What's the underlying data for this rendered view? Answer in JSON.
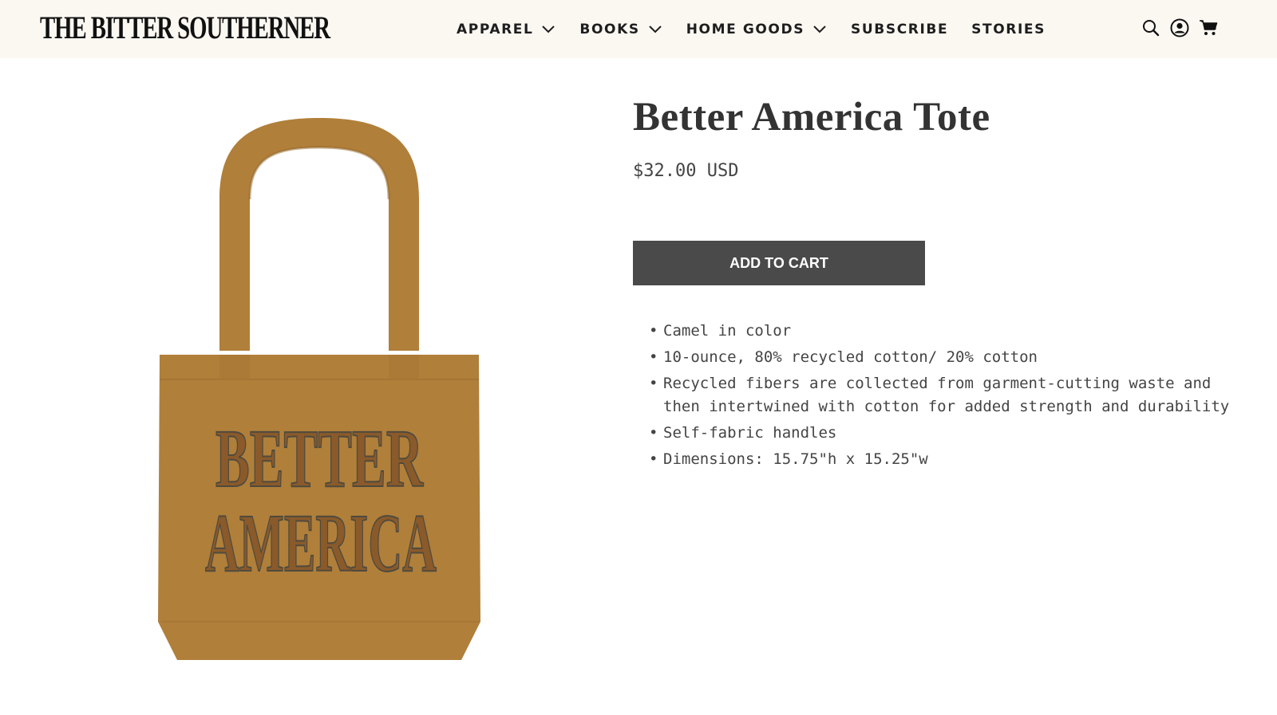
{
  "header": {
    "logo_text": "THE BITTER SOUTHERNER",
    "nav": [
      {
        "label": "APPAREL",
        "has_dropdown": true
      },
      {
        "label": "BOOKS",
        "has_dropdown": true
      },
      {
        "label": "HOME GOODS",
        "has_dropdown": true
      },
      {
        "label": "SUBSCRIBE",
        "has_dropdown": false
      },
      {
        "label": "STORIES",
        "has_dropdown": false
      }
    ],
    "icons": [
      "search-icon",
      "account-icon",
      "cart-icon"
    ],
    "background": "#fbf8f2"
  },
  "product": {
    "title": "Better America Tote",
    "price": "$32.00 USD",
    "add_to_cart_label": "ADD TO CART",
    "image_print_line1": "BETTER",
    "image_print_line2": "AMERICA",
    "features": [
      "Camel in color",
      "10-ounce, 80% recycled cotton/ 20% cotton",
      "Recycled fibers are collected from garment-cutting waste and then intertwined with cotton for added strength and durability",
      "Self-fabric handles",
      "Dimensions: 15.75\"h x 15.25\"w"
    ],
    "colors": {
      "tote": "#b07f3a",
      "button": "#4a4a4a"
    }
  }
}
